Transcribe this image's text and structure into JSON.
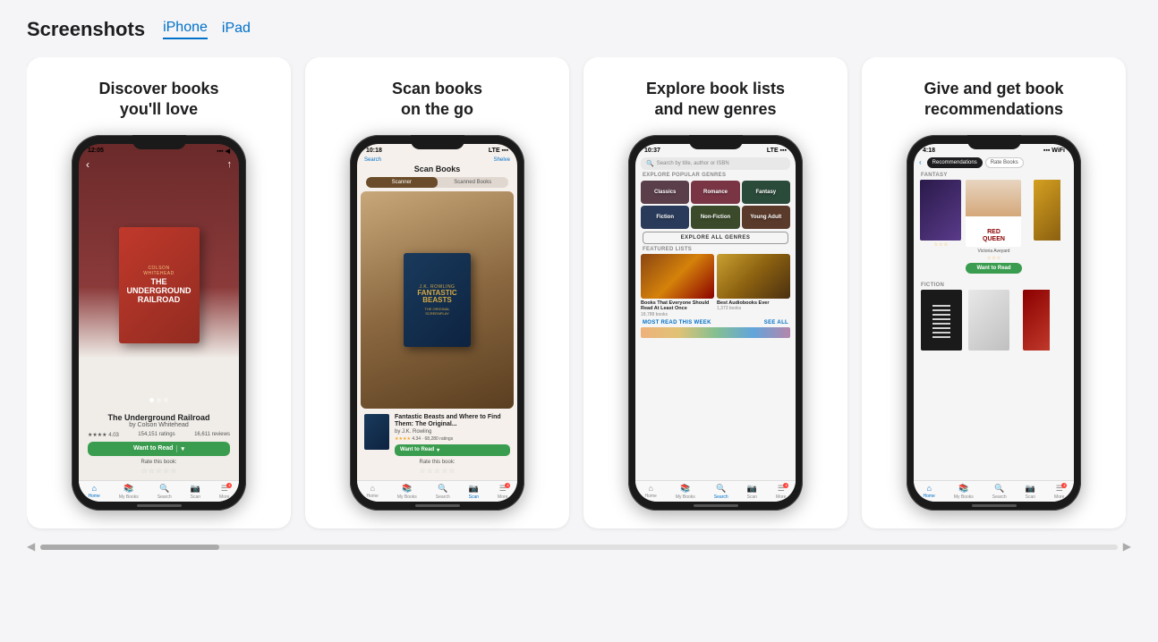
{
  "header": {
    "title": "Screenshots",
    "tabs": [
      {
        "label": "iPhone",
        "active": true
      },
      {
        "label": "iPad",
        "active": false
      }
    ]
  },
  "cards": [
    {
      "id": "discover",
      "title": "Discover books\nyou'll love",
      "phone": {
        "time": "12:05",
        "screen": "screen1"
      }
    },
    {
      "id": "scan",
      "title": "Scan books\non the go",
      "phone": {
        "time": "10:18",
        "screen": "screen2"
      }
    },
    {
      "id": "explore",
      "title": "Explore book lists\nand new genres",
      "phone": {
        "time": "10:37",
        "screen": "screen3"
      }
    },
    {
      "id": "recommend",
      "title": "Give and get book\nrecommendations",
      "phone": {
        "time": "4:18",
        "screen": "screen4"
      }
    }
  ],
  "screen1": {
    "book_title": "The Underground Railroad",
    "book_author": "by Colson Whitehead",
    "ratings": "4.03",
    "ratings_count": "154,151 ratings",
    "reviews_count": "16,611 reviews",
    "want_to_read": "Want to Read",
    "rate_this_book": "Rate this book:",
    "back_icon": "‹",
    "share_icon": "↑"
  },
  "screen2": {
    "back_label": "Search",
    "title": "Scan Books",
    "shelve_label": "Shelve",
    "scanner_tab": "Scanner",
    "scanned_books_tab": "Scanned Books",
    "result_title": "Fantastic Beasts and Where to Find Them: The Original...",
    "result_author": "by J.K. Rowling",
    "result_ratings": "4.34 · 68,280 ratings",
    "want_to_read": "Want to Read",
    "rate_this_book": "Rate this book:"
  },
  "screen3": {
    "search_placeholder": "Search by title, author or ISBN",
    "explore_popular_genres": "EXPLORE POPULAR GENRES",
    "genres": [
      {
        "label": "Classics",
        "color": "#5a3e4a"
      },
      {
        "label": "Romance",
        "color": "#6b3040"
      },
      {
        "label": "Fantasy",
        "color": "#2a4a3a"
      },
      {
        "label": "Fiction",
        "color": "#2a3a5a"
      },
      {
        "label": "Non-Fiction",
        "color": "#3a4a2a"
      },
      {
        "label": "Young Adult",
        "color": "#5a3a2a"
      }
    ],
    "explore_all": "EXPLORE ALL GENRES",
    "featured_lists": "FEATURED LISTS",
    "lists": [
      {
        "name": "Books That Everyone Should Read At Least Once",
        "count": "18,788 books"
      },
      {
        "name": "Best Audiobooks Ever",
        "count": "1,373 books"
      }
    ],
    "most_read_this_week": "MOST READ THIS WEEK",
    "see_all": "SEE ALL"
  },
  "screen4": {
    "back_icon": "‹",
    "tabs": [
      "Recommendations",
      "Rate Books"
    ],
    "fantasy_label": "FANTASY",
    "fiction_label": "FICTION",
    "book_title": "Red Queen",
    "book_author": "Victoria Aveyard",
    "want_to_read": "Want to Read"
  },
  "scroll": {
    "left_arrow": "◀",
    "right_arrow": "▶"
  }
}
